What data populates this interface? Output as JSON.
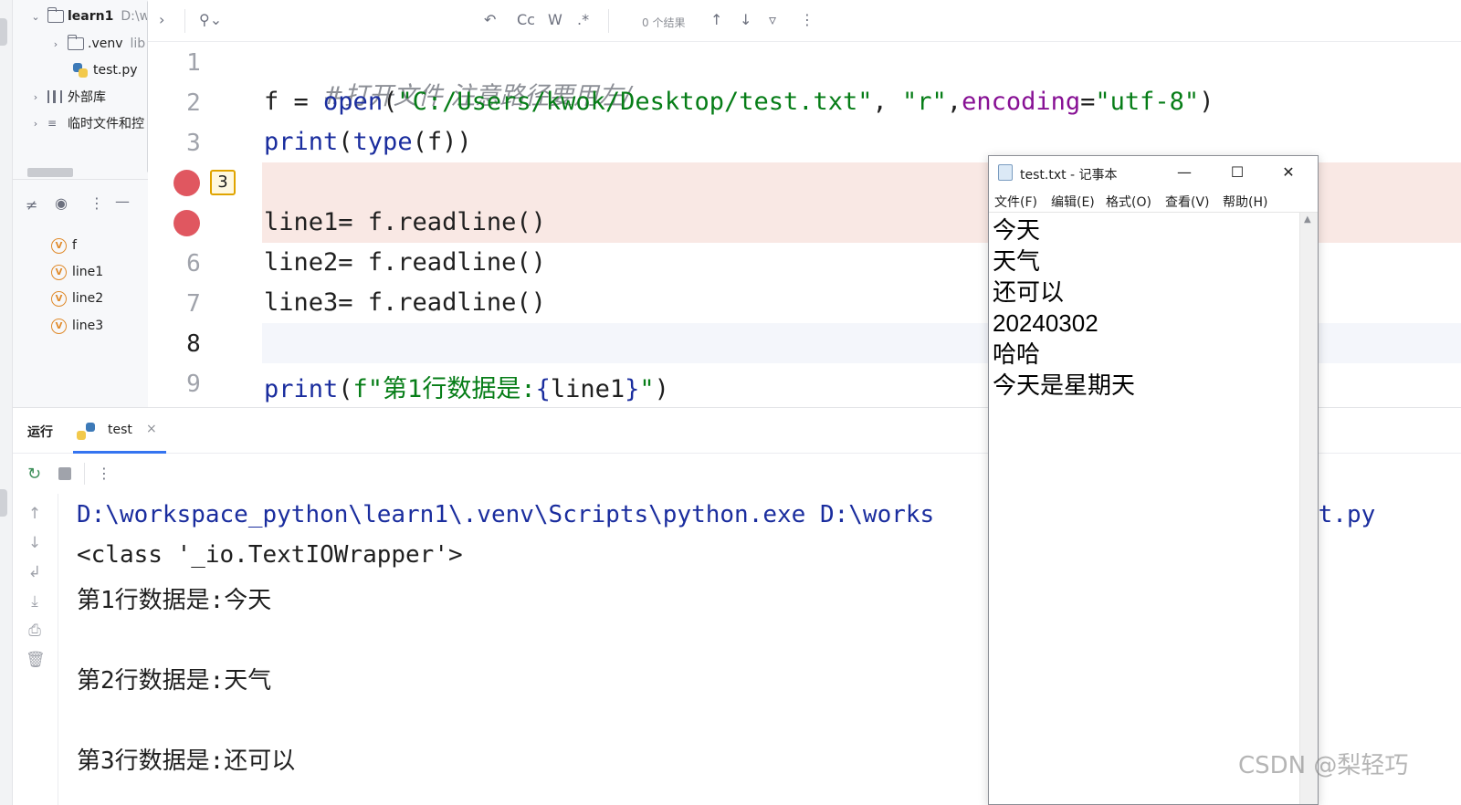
{
  "project_tree": {
    "items": [
      {
        "label": "learn1",
        "detail": "D:\\w"
      },
      {
        "label": ".venv",
        "detail": "lib"
      },
      {
        "label": "test.py",
        "detail": ""
      },
      {
        "label": "外部库",
        "detail": ""
      },
      {
        "label": "临时文件和控",
        "detail": ""
      }
    ]
  },
  "variables": {
    "items": [
      "f",
      "line1",
      "line2",
      "line3"
    ]
  },
  "toolbar": {
    "search_icon": "search-icon",
    "case_label": "Cc",
    "word_label": "W",
    "regex_label": ".*",
    "results_text": "0 个结果"
  },
  "editor": {
    "lines": [
      {
        "number": "1",
        "comment": "#打开文件 注意路径要用左/"
      },
      {
        "number": "2",
        "f": "f",
        "eq": " = ",
        "fn": "open",
        "p1": "(",
        "s1": "\"C:/Users/kwok/Desktop/test.txt\"",
        "c1": ", ",
        "s2": "\"r\"",
        "c2": ",",
        "kw": "encoding",
        "eq2": "=",
        "s3": "\"utf-8\"",
        "p2": ")"
      },
      {
        "number": "3",
        "fn1": "print",
        "p1": "(",
        "fn2": "type",
        "rest": "(f))"
      },
      {
        "number": "",
        "breakpoint_count": "3"
      },
      {
        "number": "",
        "text": "line1= f.readline()"
      },
      {
        "number": "6",
        "text": "line2= f.readline()"
      },
      {
        "number": "7",
        "text": "line3= f.readline()"
      },
      {
        "number": "8"
      },
      {
        "number": "9",
        "fn": "print",
        "p1": "(",
        "s1": "f\"第1行数据是:",
        "b1": "{",
        "var": "line1",
        "b2": "}",
        "s2": "\"",
        "p2": ")"
      }
    ]
  },
  "run_panel": {
    "title": "运行",
    "tab_label": "test",
    "output": {
      "path_line_start": "D:\\workspace_python\\learn1\\.venv\\Scripts\\python.exe D:\\works",
      "path_line_end": "st.py",
      "class_line": "<class '_io.TextIOWrapper'>",
      "line1": "第1行数据是:今天",
      "line2": "第2行数据是:天气",
      "line3": "第3行数据是:还可以"
    }
  },
  "notepad": {
    "title": "test.txt - 记事本",
    "menu": [
      "文件(F)",
      "编辑(E)",
      "格式(O)",
      "查看(V)",
      "帮助(H)"
    ],
    "content": [
      "今天",
      "天气",
      "还可以",
      "20240302",
      "哈哈",
      "今天是星期天"
    ]
  },
  "watermark": "CSDN @梨轻巧",
  "colors": {
    "breakpoint": "#e05760",
    "keyword_fn": "#1a2d9e",
    "string": "#067d17",
    "kwarg": "#871094"
  }
}
